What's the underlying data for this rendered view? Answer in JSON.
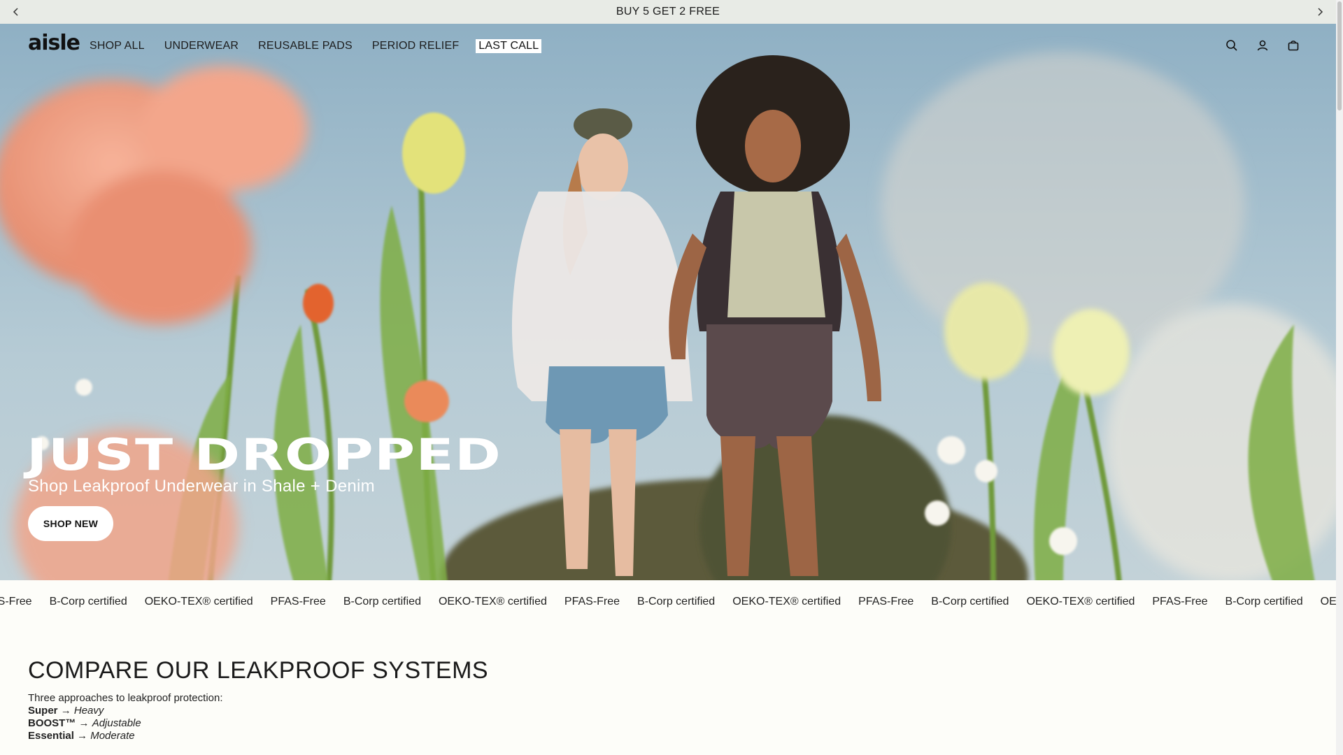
{
  "announcement": {
    "text": "BUY 5 GET 2 FREE",
    "prev_icon": "chevron-left-icon",
    "next_icon": "chevron-right-icon"
  },
  "nav": {
    "logo": "aisle",
    "items": [
      {
        "label": "SHOP ALL"
      },
      {
        "label": "UNDERWEAR"
      },
      {
        "label": "REUSABLE PADS"
      },
      {
        "label": "PERIOD RELIEF"
      },
      {
        "label": "LAST CALL"
      }
    ],
    "icons": [
      "search-icon",
      "account-icon",
      "bag-icon"
    ]
  },
  "hero": {
    "title": "JUST DROPPED",
    "subtitle": "Shop Leakproof Underwear in Shale + Denim",
    "button": "SHOP NEW"
  },
  "marquee": {
    "items": [
      "AS-Free",
      "B-Corp certified",
      "OEKO-TEX® certified",
      "PFAS-Free",
      "B-Corp certified",
      "OEKO-TEX® certified",
      "PFAS-Free",
      "B-Corp certified",
      "OEKO-TEX® certified",
      "PFAS-Free",
      "B-Corp certified",
      "OEKO-TEX® certified",
      "PFAS-Free",
      "B-Corp certified",
      "OEKO-TEX®"
    ]
  },
  "compare": {
    "title": "COMPARE OUR LEAKPROOF SYSTEMS",
    "intro": "Three approaches to leakproof protection:",
    "arrow": "→",
    "systems": [
      {
        "name": "Super",
        "level": "Heavy"
      },
      {
        "name": "BOOST™",
        "level": "Adjustable"
      },
      {
        "name": "Essential",
        "level": "Moderate"
      }
    ]
  },
  "colors": {
    "accent": "#ffffff",
    "sky": "#a6c0ce",
    "text": "#111111"
  }
}
